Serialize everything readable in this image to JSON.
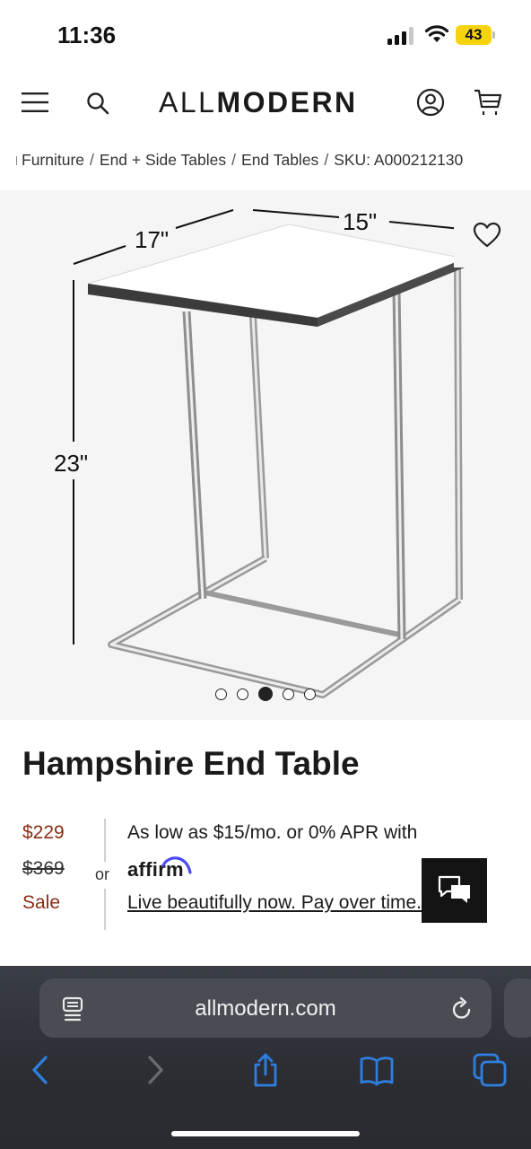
{
  "status_bar": {
    "time": "11:36",
    "battery": "43",
    "battery_color": "#f5d40f"
  },
  "header": {
    "logo_light": "ALL",
    "logo_bold": "MODERN",
    "icons": [
      "menu-icon",
      "search-icon",
      "account-icon",
      "cart-icon"
    ]
  },
  "breadcrumb": {
    "items": [
      "Furniture",
      "End + Side Tables",
      "End Tables",
      "SKU: A000212130"
    ],
    "separator": "/"
  },
  "gallery": {
    "dimensions": {
      "width": "17\"",
      "depth": "15\"",
      "height": "23\""
    },
    "dots_total": 5,
    "active_dot": 3,
    "favorite_icon": "heart-icon"
  },
  "product": {
    "title": "Hampshire End Table",
    "price": "$229",
    "was_price": "$369",
    "sale_label": "Sale",
    "or_label": "or",
    "financing_text": "As low as $15/mo. or 0% APR with",
    "affirm_word": "affirm",
    "financing_cta": "Live beautifully now. Pay over time.",
    "price_color": "#8a2b13"
  },
  "chat": {
    "icon": "chat-icon"
  },
  "browser": {
    "url": "allmodern.com",
    "toolbar": [
      "back-icon",
      "forward-icon",
      "share-icon",
      "bookmarks-icon",
      "tabs-icon"
    ],
    "tint_color": "#2f7fe0"
  }
}
